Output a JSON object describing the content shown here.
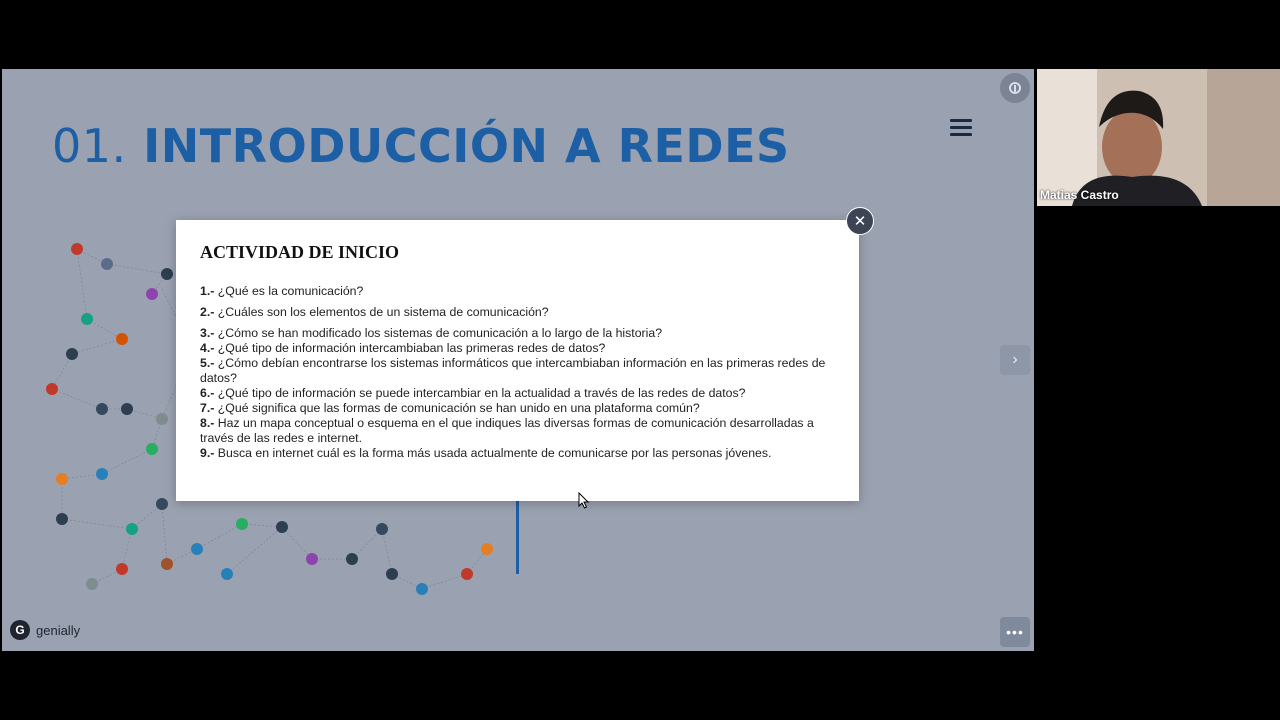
{
  "slide": {
    "title_number": "01.",
    "title_text": "INTRODUCCIÓN A REDES",
    "brand": "genially",
    "next_label": "›",
    "more_label": "•••"
  },
  "modal": {
    "title": "ACTIVIDAD DE INICIO",
    "close_label": "✕",
    "questions": [
      {
        "n": "1.-",
        "text": " ¿Qué es la comunicación?"
      },
      {
        "n": "2.-",
        "text": " ¿Cuáles son los elementos de un sistema de comunicación?"
      },
      {
        "n": "3.-",
        "text": " ¿Cómo se han modificado los sistemas de comunicación a lo largo de la historia?"
      },
      {
        "n": "4.-",
        "text": " ¿Qué tipo de información intercambiaban las primeras redes de datos?"
      },
      {
        "n": "5.-",
        "text": " ¿Cómo debían encontrarse los sistemas informáticos que intercambiaban información en las primeras redes de datos?"
      },
      {
        "n": "6.-",
        "text": " ¿Qué tipo de información se puede intercambiar en la actualidad a través de las redes de datos?"
      },
      {
        "n": "7.-",
        "text": " ¿Qué significa que las formas de comunicación se han unido en una plataforma común?"
      },
      {
        "n": "8.-",
        "text": " Haz un mapa conceptual o esquema en el que indiques las diversas formas de comunicación desarrolladas a través de las redes e internet."
      },
      {
        "n": "9.-",
        "text": " Busca en internet cuál es la forma más usada actualmente de comunicarse por las personas jóvenes."
      }
    ]
  },
  "participant": {
    "name": "Matias Castro"
  },
  "icons": {
    "menu": "hamburger-menu-icon",
    "close": "close-icon",
    "next": "chevron-right-icon",
    "more": "more-dots-icon",
    "top": "touch-icon"
  },
  "colors": {
    "title_blue": "#1d5fa5",
    "slide_bg": "#9aa1b0",
    "modal_bg": "#ffffff"
  }
}
